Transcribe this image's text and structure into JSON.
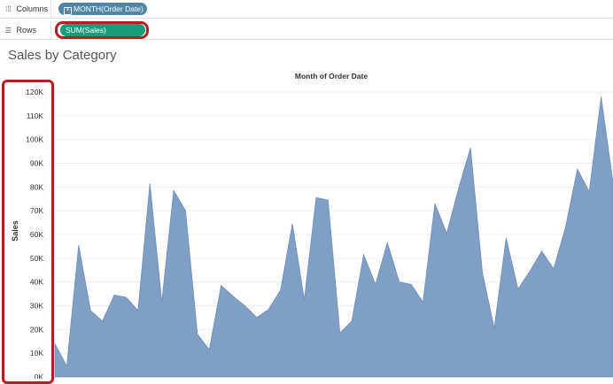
{
  "shelves": {
    "columns": {
      "label": "Columns",
      "pill": "MONTH(Order Date)",
      "pill_color": "#4f86a8"
    },
    "rows": {
      "label": "Rows",
      "pill": "SUM(Sales)",
      "pill_color": "#1a9b7a"
    }
  },
  "sheet_title": "Sales by Category",
  "chart_data": {
    "type": "area",
    "xlabel": "Month of Order Date",
    "ylabel": "Sales",
    "ylim": [
      0,
      120000
    ],
    "y_ticks": [
      {
        "value": 0,
        "label": "0K"
      },
      {
        "value": 10000,
        "label": "10K"
      },
      {
        "value": 20000,
        "label": "20K"
      },
      {
        "value": 30000,
        "label": "30K"
      },
      {
        "value": 40000,
        "label": "40K"
      },
      {
        "value": 50000,
        "label": "50K"
      },
      {
        "value": 60000,
        "label": "60K"
      },
      {
        "value": 70000,
        "label": "70K"
      },
      {
        "value": 80000,
        "label": "80K"
      },
      {
        "value": 90000,
        "label": "90K"
      },
      {
        "value": 100000,
        "label": "100K"
      },
      {
        "value": 110000,
        "label": "110K"
      },
      {
        "value": 120000,
        "label": "120K"
      }
    ],
    "grid": true,
    "color": "#7f9fc5",
    "values": [
      14000,
      4500,
      55500,
      28000,
      23500,
      34500,
      33500,
      28000,
      81500,
      31500,
      78500,
      70000,
      18000,
      11500,
      38500,
      34000,
      30000,
      25000,
      28500,
      36500,
      64500,
      32500,
      75500,
      74500,
      18500,
      23500,
      51500,
      39000,
      56500,
      40000,
      39000,
      31500,
      73000,
      60500,
      79500,
      96500,
      44000,
      20500,
      58500,
      37000,
      44500,
      53000,
      45500,
      63000,
      87500,
      78000,
      118000,
      82000
    ]
  }
}
